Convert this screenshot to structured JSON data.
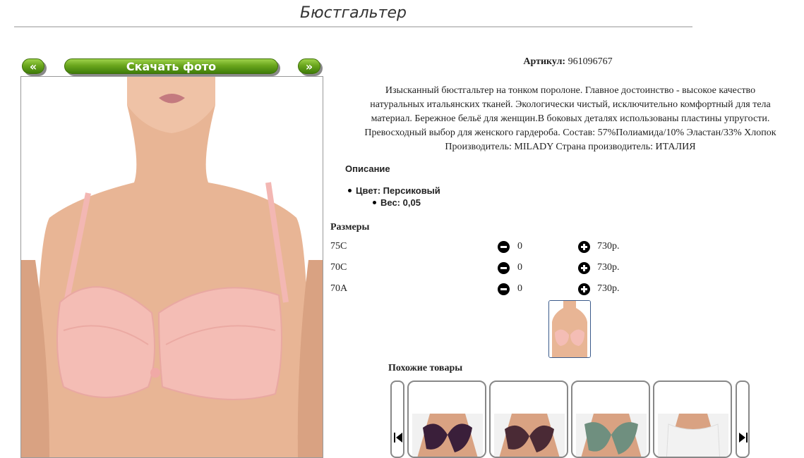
{
  "page": {
    "title": "Бюстгальтер"
  },
  "photo_nav": {
    "prev_label": "«",
    "download_label": "Скачать фото",
    "next_label": "»"
  },
  "article": {
    "label": "Артикул:",
    "value": "961096767"
  },
  "description": {
    "lines": [
      "Изысканный бюстгальтер на тонком поролоне. Главное достоинство - высокое качество",
      "натуральных итальянских тканей. Экологически чистый, исключительно комфортный для тела",
      "материал. Бережное бельё для женщин.В боковых деталях использованы пластины упругости.",
      "Превосходный выбор для женского гардероба. Состав: 57%Полиамида/10% Эластан/33% Хлопок",
      "Производитель: MILADY Страна производитель: ИТАЛИЯ"
    ]
  },
  "details": {
    "heading": "Описание",
    "color": "Цвет: Персиковый",
    "weight": "Вес: 0,05"
  },
  "sizes": {
    "heading": "Размеры",
    "rows": [
      {
        "name": "75C",
        "qty": "0",
        "price": "730р."
      },
      {
        "name": "70C",
        "qty": "0",
        "price": "730р."
      },
      {
        "name": "70A",
        "qty": "0",
        "price": "730р."
      }
    ]
  },
  "similar": {
    "heading": "Похожие товары",
    "items": [
      {
        "color": "#3a1f3a"
      },
      {
        "color": "#4a2a35"
      },
      {
        "color": "#6f8f7f"
      },
      {
        "color": "#f2f2f2"
      }
    ]
  },
  "colors": {
    "accent_green": "#6aa61d",
    "product_pink": "#f2b6b0",
    "skin": "#e9b89c"
  }
}
